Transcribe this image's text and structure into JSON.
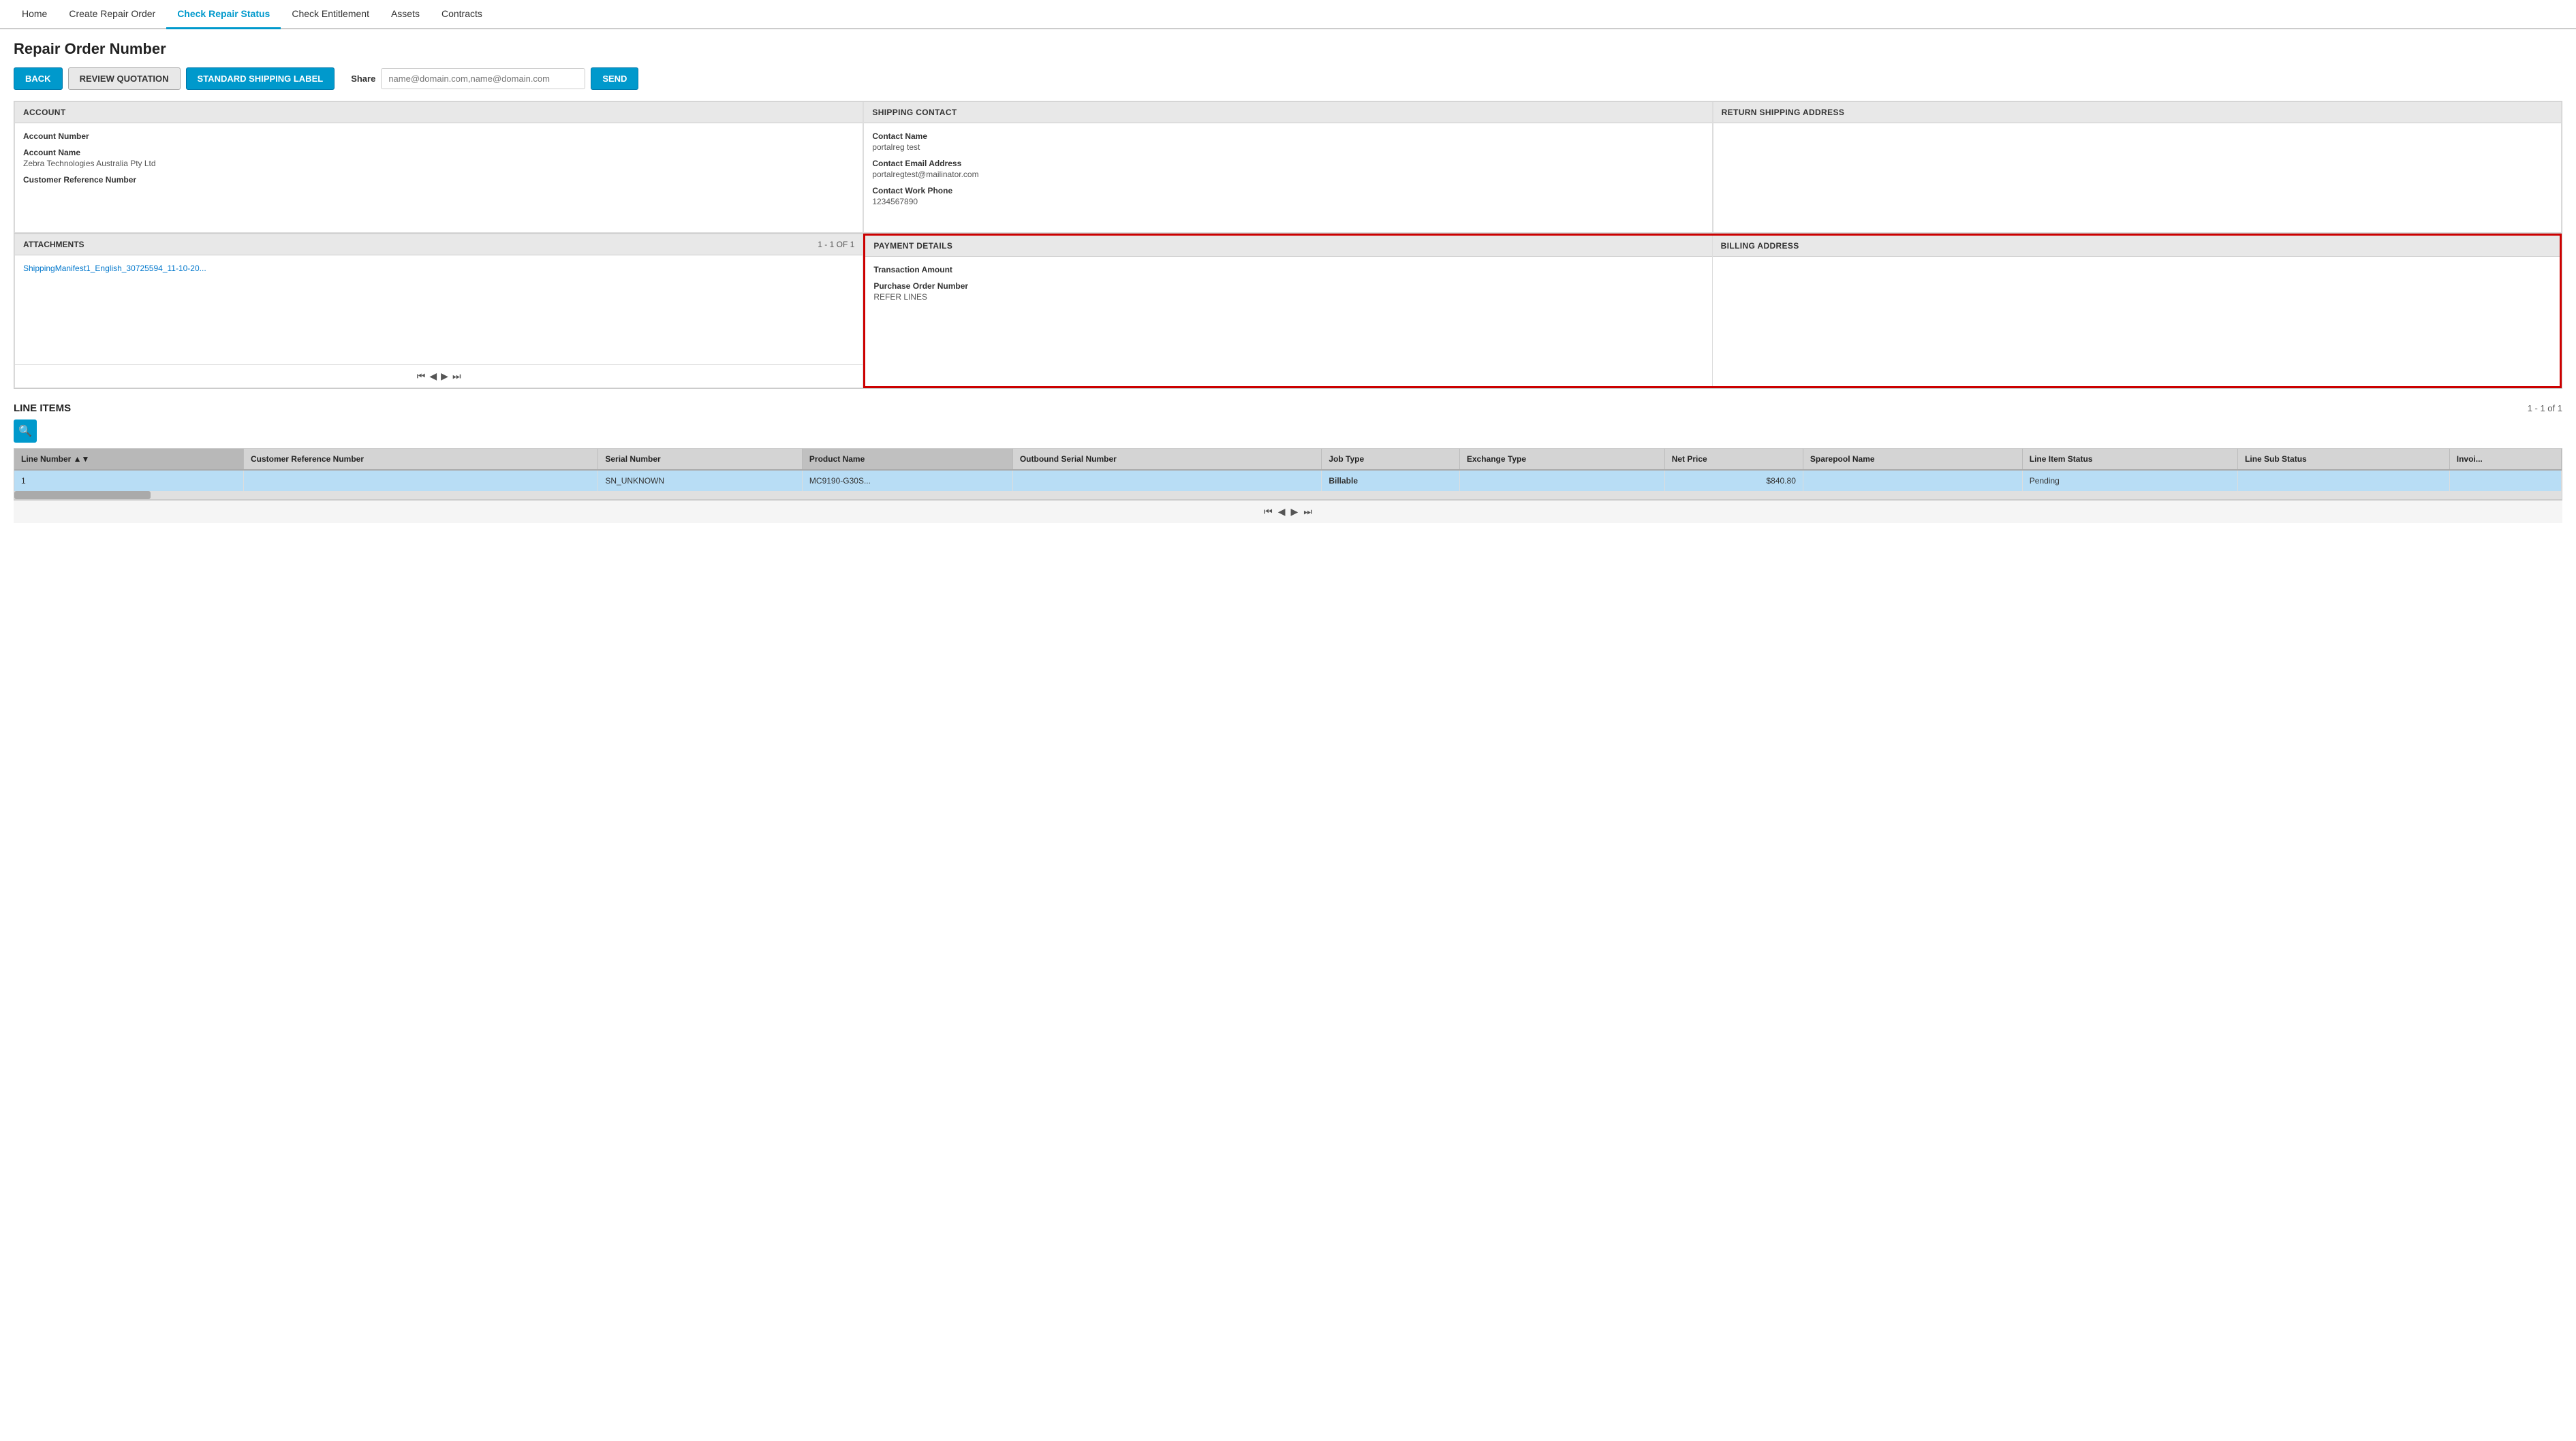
{
  "nav": {
    "items": [
      {
        "id": "home",
        "label": "Home",
        "active": false
      },
      {
        "id": "create-repair",
        "label": "Create Repair Order",
        "active": false
      },
      {
        "id": "check-repair",
        "label": "Check Repair Status",
        "active": true
      },
      {
        "id": "check-entitlement",
        "label": "Check Entitlement",
        "active": false
      },
      {
        "id": "assets",
        "label": "Assets",
        "active": false
      },
      {
        "id": "contracts",
        "label": "Contracts",
        "active": false
      }
    ]
  },
  "page": {
    "title": "Repair Order Number"
  },
  "toolbar": {
    "back_label": "BACK",
    "review_label": "REVIEW QUOTATION",
    "shipping_label": "STANDARD SHIPPING LABEL",
    "share_label": "Share",
    "share_placeholder": "name@domain.com,name@domain.com",
    "send_label": "SEND"
  },
  "account": {
    "header": "ACCOUNT",
    "fields": [
      {
        "label": "Account Number",
        "value": ""
      },
      {
        "label": "Account Name",
        "value": "Zebra Technologies Australia Pty Ltd"
      },
      {
        "label": "Customer Reference Number",
        "value": ""
      }
    ]
  },
  "shipping_contact": {
    "header": "SHIPPING CONTACT",
    "fields": [
      {
        "label": "Contact Name",
        "value": "portalreg test"
      },
      {
        "label": "Contact Email Address",
        "value": "portalregtest@mailinator.com"
      },
      {
        "label": "Contact Work Phone",
        "value": "1234567890"
      }
    ]
  },
  "return_shipping": {
    "header": "RETURN SHIPPING ADDRESS",
    "fields": []
  },
  "attachments": {
    "header": "ATTACHMENTS",
    "count": "1 - 1 of 1",
    "items": [
      {
        "name": "ShippingManifest1_English_30725594_11-10-20..."
      }
    ]
  },
  "payment_details": {
    "header": "PAYMENT DETAILS",
    "fields": [
      {
        "label": "Transaction Amount",
        "value": ""
      },
      {
        "label": "Purchase Order Number",
        "value": "REFER LINES"
      }
    ]
  },
  "billing_address": {
    "header": "BILLING ADDRESS",
    "fields": []
  },
  "line_items": {
    "title": "LINE ITEMS",
    "count": "1 - 1 of 1",
    "search_icon": "🔍",
    "columns": [
      {
        "id": "line-number",
        "label": "Line Number",
        "sorted": true
      },
      {
        "id": "customer-ref",
        "label": "Customer Reference Number"
      },
      {
        "id": "serial-number",
        "label": "Serial Number"
      },
      {
        "id": "product-name",
        "label": "Product Name",
        "highlighted": true
      },
      {
        "id": "outbound-serial",
        "label": "Outbound Serial Number"
      },
      {
        "id": "job-type",
        "label": "Job Type"
      },
      {
        "id": "exchange-type",
        "label": "Exchange Type"
      },
      {
        "id": "net-price",
        "label": "Net Price"
      },
      {
        "id": "sparepool-name",
        "label": "Sparepool Name"
      },
      {
        "id": "line-item-status",
        "label": "Line Item Status"
      },
      {
        "id": "line-sub-status",
        "label": "Line Sub Status"
      },
      {
        "id": "invoice",
        "label": "Invoi..."
      }
    ],
    "rows": [
      {
        "line_number": "1",
        "customer_ref": "",
        "serial_number": "SN_UNKNOWN",
        "product_name": "MC9190-G30S...",
        "outbound_serial": "",
        "job_type": "Billable",
        "exchange_type": "",
        "net_price": "$840.80",
        "sparepool_name": "",
        "line_item_status": "Pending",
        "line_sub_status": "",
        "invoice": ""
      }
    ],
    "pagination": {
      "first": "⏮",
      "prev": "◀",
      "next": "▶",
      "last": "⏭"
    }
  }
}
